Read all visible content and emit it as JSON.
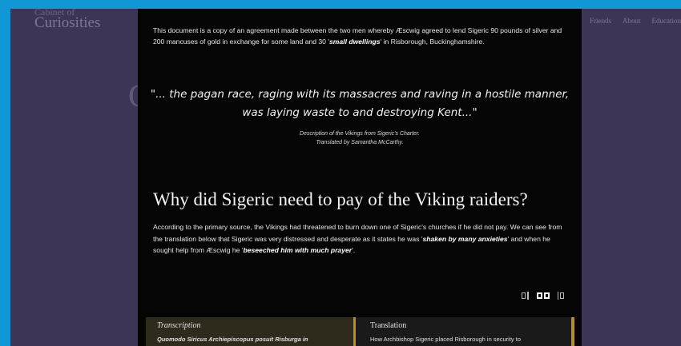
{
  "background_site": {
    "logo_top": "Cabinet of",
    "logo_main": "Curiosities",
    "nav": [
      "Friends",
      "About",
      "Education"
    ],
    "bg_letter": "C"
  },
  "modal": {
    "intro_pre": "This document is a copy of an agreement made between the two men whereby Æscwig agreed to lend Sigeric 90 pounds of silver and 200 mancuses of gold in exchange for some land and 30 '",
    "intro_em": "small dwellings",
    "intro_post": "' in Risborough, Buckinghamshire.",
    "quote": "\"... the pagan race, raging with its massacres and raving in a hostile manner, was laying waste to and destroying Kent...\"",
    "caption_line1": "Description of the Vikings from Sigeric's Charter.",
    "caption_line2": "Translated by Samantha McCarthy.",
    "heading": "Why did Sigeric need to pay of the Viking raiders?",
    "body_1": "According to the primary source, the Vikings had threatened to burn down one of Sigeric's churches if he did not pay. We can see from the translation below that Sigeric was very distressed and desperate as it states he was '",
    "body_em1": "shaken by many anxieties",
    "body_2": "' and when he sought help from Æscwig he '",
    "body_em2": "beseeched him with much prayer",
    "body_3": "'.",
    "panels": {
      "left_title": "Transcription",
      "left_text": "Quomodo Siricus Archiepiscopus posuit Risburga in",
      "right_title": "Translation",
      "right_text": "How Archbishop Sigeric placed Risborough in security to"
    }
  },
  "colors": {
    "frame": "#1196d6",
    "site_bg": "#3d3556",
    "modal_bg": "#050505",
    "gold_accent": "#b98d1f"
  }
}
